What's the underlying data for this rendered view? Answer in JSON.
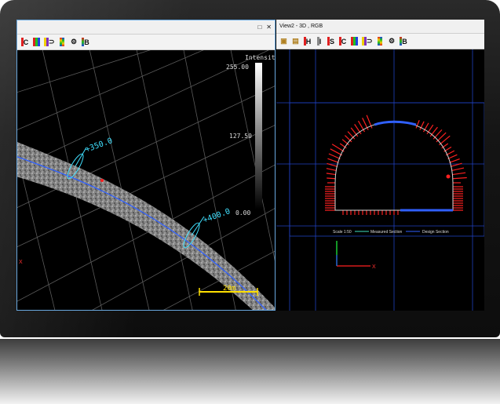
{
  "left_view": {
    "title": "",
    "toolbar_letters": [
      "C",
      "",
      "",
      "",
      "",
      "B"
    ],
    "intensity": {
      "label": "Intensity",
      "max": "255.00",
      "mid": "127.50",
      "min": "0.00"
    },
    "stations": [
      "+350.0",
      "+400.0"
    ],
    "scale_label": "20m",
    "axis_label": "X"
  },
  "right_view": {
    "title": "View2 - 3D , RGB",
    "toolbar_letters": [
      "",
      "",
      "H",
      "I",
      "S",
      "C",
      "",
      "",
      "",
      "",
      "B"
    ],
    "legend": {
      "scale": "Scale 1:50",
      "measured": "Measured Section",
      "design": "Design Section"
    },
    "axis_label": "X"
  },
  "colors": {
    "accent_blue": "#3060ff",
    "cyan": "#40e0ff",
    "red": "#ff2020",
    "green": "#20ff40",
    "yellow": "#ffe000"
  },
  "icons": [
    "maximize-icon",
    "close-icon",
    "color-swatch-icon",
    "gear-icon",
    "cube-icon"
  ]
}
